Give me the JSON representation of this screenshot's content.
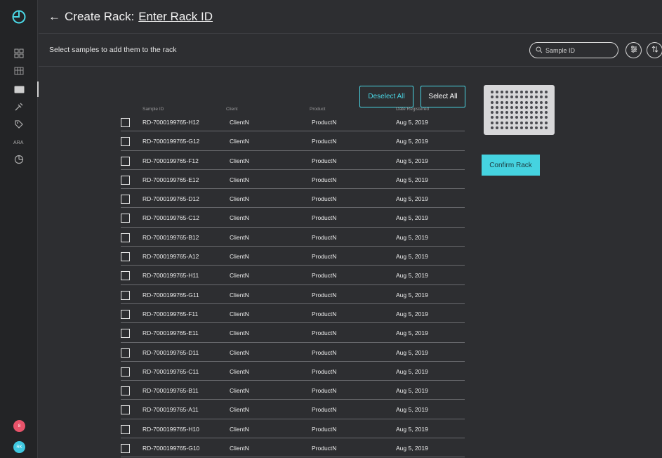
{
  "header": {
    "back_arrow": "←",
    "title": "Create Rack:",
    "rack_id_link": "Enter Rack ID"
  },
  "subbar": {
    "instruction": "Select samples to add them to the rack",
    "search_placeholder": "Sample ID"
  },
  "actions": {
    "deselect_all": "Deselect All",
    "select_all": "Select All",
    "confirm_rack": "Confirm Rack"
  },
  "sidebar": {
    "icons": [
      "logo-icon",
      "dashboard-icon",
      "racks-icon",
      "list-icon",
      "dna-icon",
      "tag-icon",
      "users-icon",
      "reports-icon"
    ],
    "badge_1": "8",
    "badge_2": "RK"
  },
  "table": {
    "headers": [
      "Sample ID",
      "Client",
      "Product",
      "Date Registered"
    ],
    "rows": [
      {
        "sample_id": "RD-7000199765-H12",
        "client": "ClientN",
        "product": "ProductN",
        "date": "Aug 5, 2019"
      },
      {
        "sample_id": "RD-7000199765-G12",
        "client": "ClientN",
        "product": "ProductN",
        "date": "Aug 5, 2019"
      },
      {
        "sample_id": "RD-7000199765-F12",
        "client": "ClientN",
        "product": "ProductN",
        "date": "Aug 5, 2019"
      },
      {
        "sample_id": "RD-7000199765-E12",
        "client": "ClientN",
        "product": "ProductN",
        "date": "Aug 5, 2019"
      },
      {
        "sample_id": "RD-7000199765-D12",
        "client": "ClientN",
        "product": "ProductN",
        "date": "Aug 5, 2019"
      },
      {
        "sample_id": "RD-7000199765-C12",
        "client": "ClientN",
        "product": "ProductN",
        "date": "Aug 5, 2019"
      },
      {
        "sample_id": "RD-7000199765-B12",
        "client": "ClientN",
        "product": "ProductN",
        "date": "Aug 5, 2019"
      },
      {
        "sample_id": "RD-7000199765-A12",
        "client": "ClientN",
        "product": "ProductN",
        "date": "Aug 5, 2019"
      },
      {
        "sample_id": "RD-7000199765-H11",
        "client": "ClientN",
        "product": "ProductN",
        "date": "Aug 5, 2019"
      },
      {
        "sample_id": "RD-7000199765-G11",
        "client": "ClientN",
        "product": "ProductN",
        "date": "Aug 5, 2019"
      },
      {
        "sample_id": "RD-7000199765-F11",
        "client": "ClientN",
        "product": "ProductN",
        "date": "Aug 5, 2019"
      },
      {
        "sample_id": "RD-7000199765-E11",
        "client": "ClientN",
        "product": "ProductN",
        "date": "Aug 5, 2019"
      },
      {
        "sample_id": "RD-7000199765-D11",
        "client": "ClientN",
        "product": "ProductN",
        "date": "Aug 5, 2019"
      },
      {
        "sample_id": "RD-7000199765-C11",
        "client": "ClientN",
        "product": "ProductN",
        "date": "Aug 5, 2019"
      },
      {
        "sample_id": "RD-7000199765-B11",
        "client": "ClientN",
        "product": "ProductN",
        "date": "Aug 5, 2019"
      },
      {
        "sample_id": "RD-7000199765-A11",
        "client": "ClientN",
        "product": "ProductN",
        "date": "Aug 5, 2019"
      },
      {
        "sample_id": "RD-7000199765-H10",
        "client": "ClientN",
        "product": "ProductN",
        "date": "Aug 5, 2019"
      },
      {
        "sample_id": "RD-7000199765-G10",
        "client": "ClientN",
        "product": "ProductN",
        "date": "Aug 5, 2019"
      }
    ]
  },
  "colors": {
    "accent": "#45d3e0",
    "background": "#2d2e31",
    "sidebar": "#232426",
    "badge_red": "#e8536a",
    "badge_cyan": "#3fc8e0"
  }
}
